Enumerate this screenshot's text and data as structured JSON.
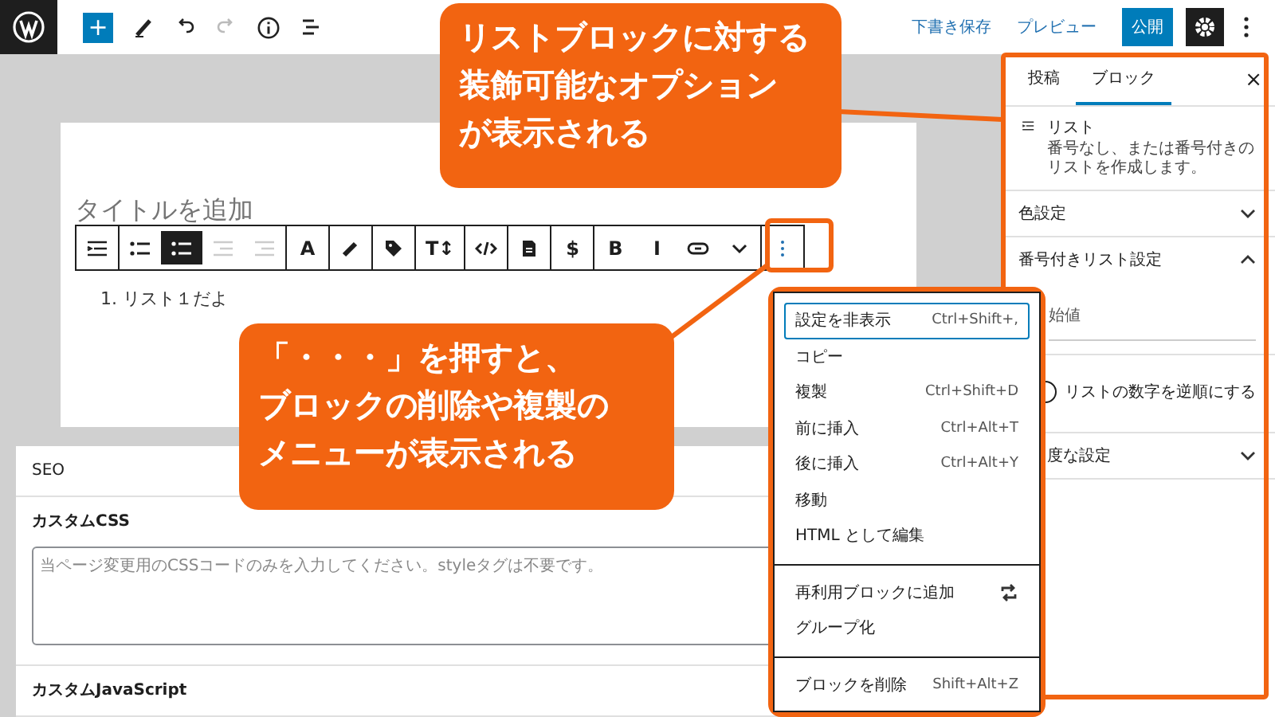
{
  "topbar": {
    "add_button": "+",
    "save_draft": "下書き保存",
    "preview": "プレビュー",
    "publish": "公開"
  },
  "editor": {
    "title_placeholder": "タイトルを追加",
    "list_item": "1. リスト１だよ",
    "toolbar": [
      [
        {
          "kind": "list-view"
        }
      ],
      [
        {
          "kind": "bullet-list",
          "selected": false,
          "disabled": false
        },
        {
          "kind": "numbered-list",
          "selected": true,
          "disabled": false
        },
        {
          "kind": "outdent",
          "selected": false,
          "disabled": true
        },
        {
          "kind": "indent",
          "selected": false,
          "disabled": true
        }
      ],
      [
        {
          "kind": "text",
          "label": "A"
        }
      ],
      [
        {
          "kind": "pen"
        }
      ],
      [
        {
          "kind": "tag"
        }
      ],
      [
        {
          "kind": "text",
          "label": "T↕"
        }
      ],
      [
        {
          "kind": "code"
        }
      ],
      [
        {
          "kind": "document"
        }
      ],
      [
        {
          "kind": "text",
          "label": "$"
        }
      ],
      [
        {
          "kind": "text",
          "label": "B"
        },
        {
          "kind": "text",
          "label": "I"
        },
        {
          "kind": "link"
        },
        {
          "kind": "chevron"
        }
      ],
      [
        {
          "kind": "kebab"
        }
      ]
    ]
  },
  "meta": {
    "sections": [
      {
        "title": "SEO"
      },
      {
        "title": "カスタムCSS",
        "placeholder": "当ページ変更用のCSSコードのみを入力してください。styleタグは不要です。"
      },
      {
        "title": "カスタムJavaScript"
      }
    ]
  },
  "sidebar": {
    "tabs": [
      {
        "label": "投稿",
        "selected": false
      },
      {
        "label": "ブロック",
        "selected": true
      }
    ],
    "close": "×",
    "block": {
      "name": "リスト",
      "description": "番号なし、または番号付きのリストを作成します。"
    },
    "panels": [
      {
        "title": "色設定",
        "expanded": false
      },
      {
        "title": "番号付きリスト設定",
        "expanded": true,
        "field_label": "始値",
        "toggle": {
          "label": "リストの数字を逆順にする",
          "checked": false
        }
      },
      {
        "title": "度な設定",
        "expanded": false
      }
    ]
  },
  "menu": {
    "groups": [
      [
        {
          "kind": "plain",
          "label": "設定を非表示",
          "shortcut": "Ctrl+Shift+,",
          "selected": true
        },
        {
          "kind": "plain",
          "label": "コピー",
          "selected": false
        },
        {
          "kind": "plain",
          "label": "複製",
          "shortcut": "Ctrl+Shift+D",
          "selected": false
        },
        {
          "kind": "plain",
          "label": "前に挿入",
          "shortcut": "Ctrl+Alt+T",
          "selected": false
        },
        {
          "kind": "plain",
          "label": "後に挿入",
          "shortcut": "Ctrl+Alt+Y",
          "selected": false
        },
        {
          "kind": "plain",
          "label": "移動",
          "selected": false
        },
        {
          "kind": "plain",
          "label": "HTML として編集",
          "selected": false
        }
      ],
      [
        {
          "kind": "reusable",
          "label": "再利用ブロックに追加",
          "selected": false
        },
        {
          "kind": "plain",
          "label": "グループ化",
          "selected": false
        }
      ],
      [
        {
          "kind": "plain",
          "label": "ブロックを削除",
          "shortcut": "Shift+Alt+Z",
          "selected": false
        }
      ]
    ]
  },
  "callouts": [
    {
      "lines": [
        "リストブロックに対する",
        "装飾可能なオプション",
        "が表示される"
      ]
    },
    {
      "lines": [
        "「・・・」を押すと、",
        "ブロックの削除や複製の",
        "メニューが表示される"
      ]
    }
  ]
}
